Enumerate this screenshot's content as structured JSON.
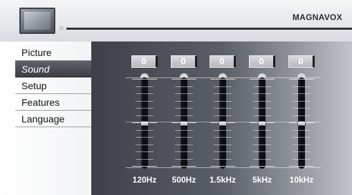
{
  "header": {
    "brand": "MAGNAVOX",
    "icon": "tv-icon"
  },
  "menu": {
    "items": [
      {
        "label": "Picture",
        "selected": false
      },
      {
        "label": "Sound",
        "selected": true
      },
      {
        "label": "Setup",
        "selected": false
      },
      {
        "label": "Features",
        "selected": false
      },
      {
        "label": "Language",
        "selected": false
      }
    ]
  },
  "equalizer": {
    "bands": [
      {
        "label": "120Hz",
        "value": "0"
      },
      {
        "label": "500Hz",
        "value": "0"
      },
      {
        "label": "1.5kHz",
        "value": "0"
      },
      {
        "label": "5kHz",
        "value": "0"
      },
      {
        "label": "10kHz",
        "value": "0"
      }
    ]
  },
  "colors": {
    "selected_item": "#4a4d53",
    "track": "#0d0e11",
    "value_box": "#c8cacf"
  }
}
